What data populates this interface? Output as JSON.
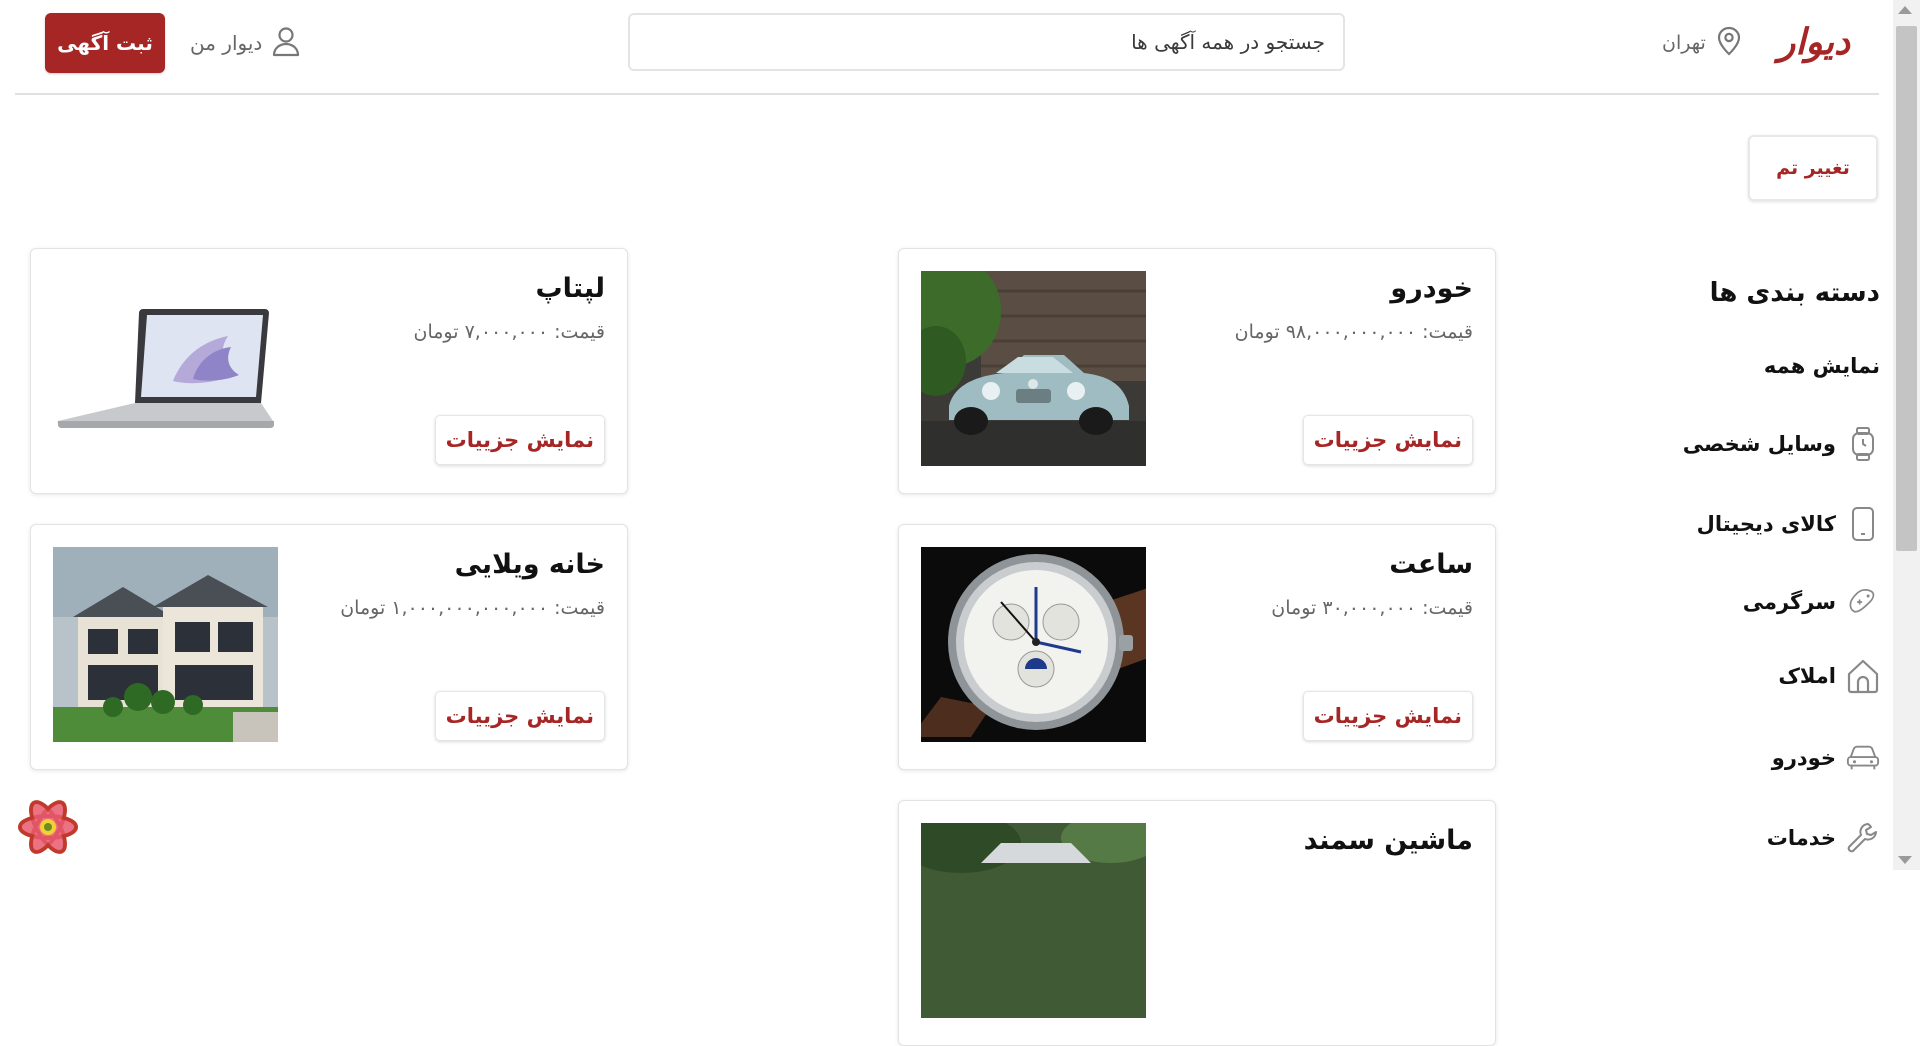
{
  "header": {
    "logo": "دیوار",
    "city": "تهران",
    "search_placeholder": "جستجو در همه آگهی ها",
    "my_divar": "دیوار من",
    "post_ad": "ثبت آگهی"
  },
  "theme_button": "تغییر تم",
  "sidebar": {
    "title": "دسته بندی ها",
    "items": [
      {
        "label": "نمایش همه",
        "icon": ""
      },
      {
        "label": "وسایل شخصی",
        "icon": "watch-icon"
      },
      {
        "label": "کالای دیجیتال",
        "icon": "phone-icon"
      },
      {
        "label": "سرگرمی",
        "icon": "gamepad-icon"
      },
      {
        "label": "املاک",
        "icon": "house-icon"
      },
      {
        "label": "خودرو",
        "icon": "car-icon"
      },
      {
        "label": "خدمات",
        "icon": "wrench-icon"
      }
    ]
  },
  "cards": [
    {
      "title": "خودرو",
      "price": "قیمت: ۹۸,۰۰۰,۰۰۰,۰۰۰ تومان",
      "button": "نمایش جزییات",
      "image": "car-image"
    },
    {
      "title": "لپتاپ",
      "price": "قیمت: ۷,۰۰۰,۰۰۰ تومان",
      "button": "نمایش جزییات",
      "image": "laptop-image"
    },
    {
      "title": "ساعت",
      "price": "قیمت: ۳۰,۰۰۰,۰۰۰ تومان",
      "button": "نمایش جزییات",
      "image": "watch-image"
    },
    {
      "title": "خانه ویلایی",
      "price": "قیمت: ۱,۰۰۰,۰۰۰,۰۰۰,۰۰۰ تومان",
      "button": "نمایش جزییات",
      "image": "villa-image"
    },
    {
      "title": "ماشین سمند",
      "price": "",
      "button": "",
      "image": "samand-image"
    }
  ],
  "colors": {
    "brand": "#a62626",
    "muted": "#666666",
    "border": "#e3e3e3"
  }
}
